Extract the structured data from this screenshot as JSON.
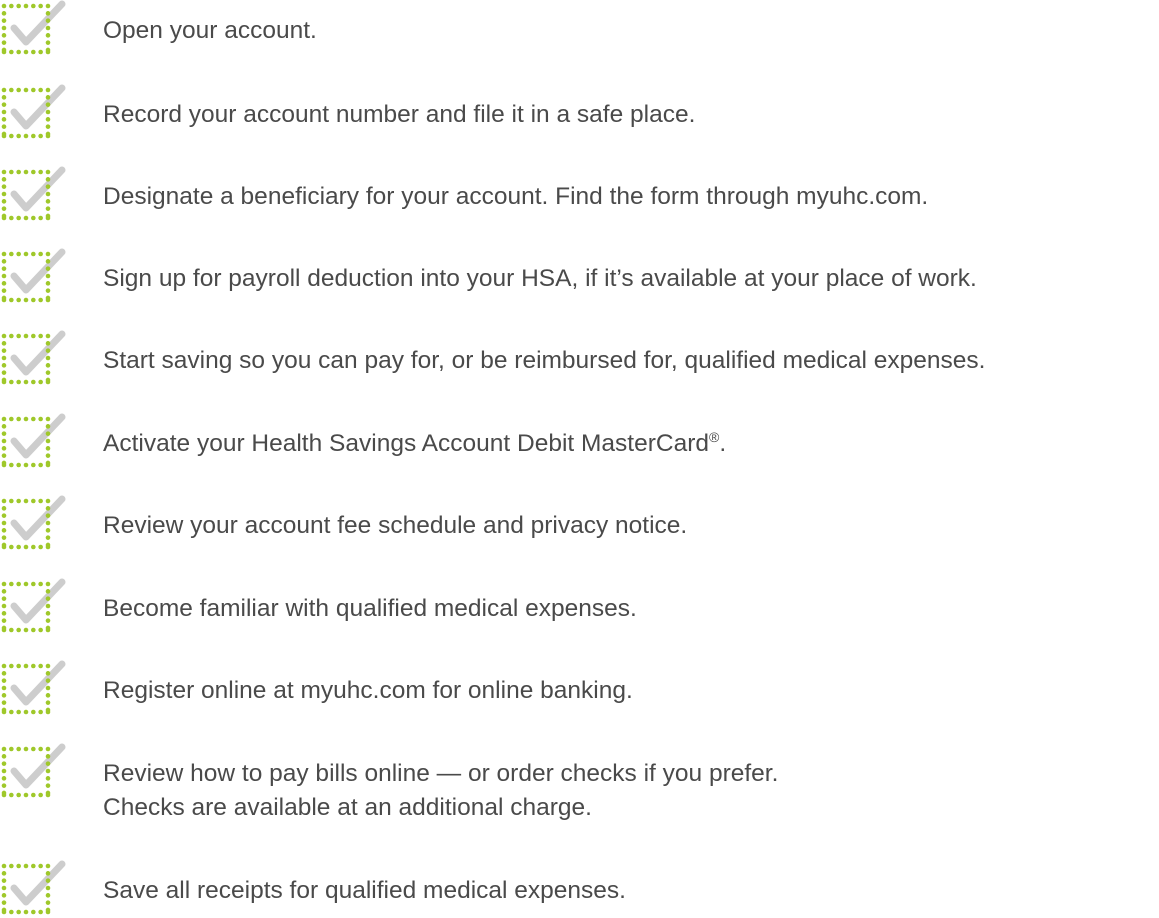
{
  "colors": {
    "checkbox_dots": "#9fc82a",
    "checkmark": "#cdcdcd",
    "text": "#4a4a4a"
  },
  "icon": "dotted-checkbox-with-checkmark",
  "checklist": {
    "items": [
      {
        "lines": [
          "Open your account."
        ]
      },
      {
        "lines": [
          "Record your account number and file it in a safe place."
        ]
      },
      {
        "lines": [
          "Designate a beneficiary for your account. Find the form through myuhc.com."
        ]
      },
      {
        "lines": [
          "Sign up for payroll deduction into your HSA, if it’s available at your place of work."
        ]
      },
      {
        "lines": [
          "Start saving so you can pay for, or be reimbursed for, qualified medical expenses."
        ]
      },
      {
        "lines": [
          "Activate your Health Savings Account Debit MasterCard"
        ],
        "sup": "®",
        "tail": "."
      },
      {
        "lines": [
          "Review your account fee schedule and privacy notice."
        ]
      },
      {
        "lines": [
          "Become familiar with qualified medical expenses."
        ]
      },
      {
        "lines": [
          "Register online at myuhc.com for online banking."
        ]
      },
      {
        "lines": [
          "Review how to pay bills online — or order checks if you prefer.",
          "Checks are available at an additional charge."
        ]
      },
      {
        "lines": [
          "Save all receipts for qualified medical expenses."
        ]
      }
    ]
  }
}
